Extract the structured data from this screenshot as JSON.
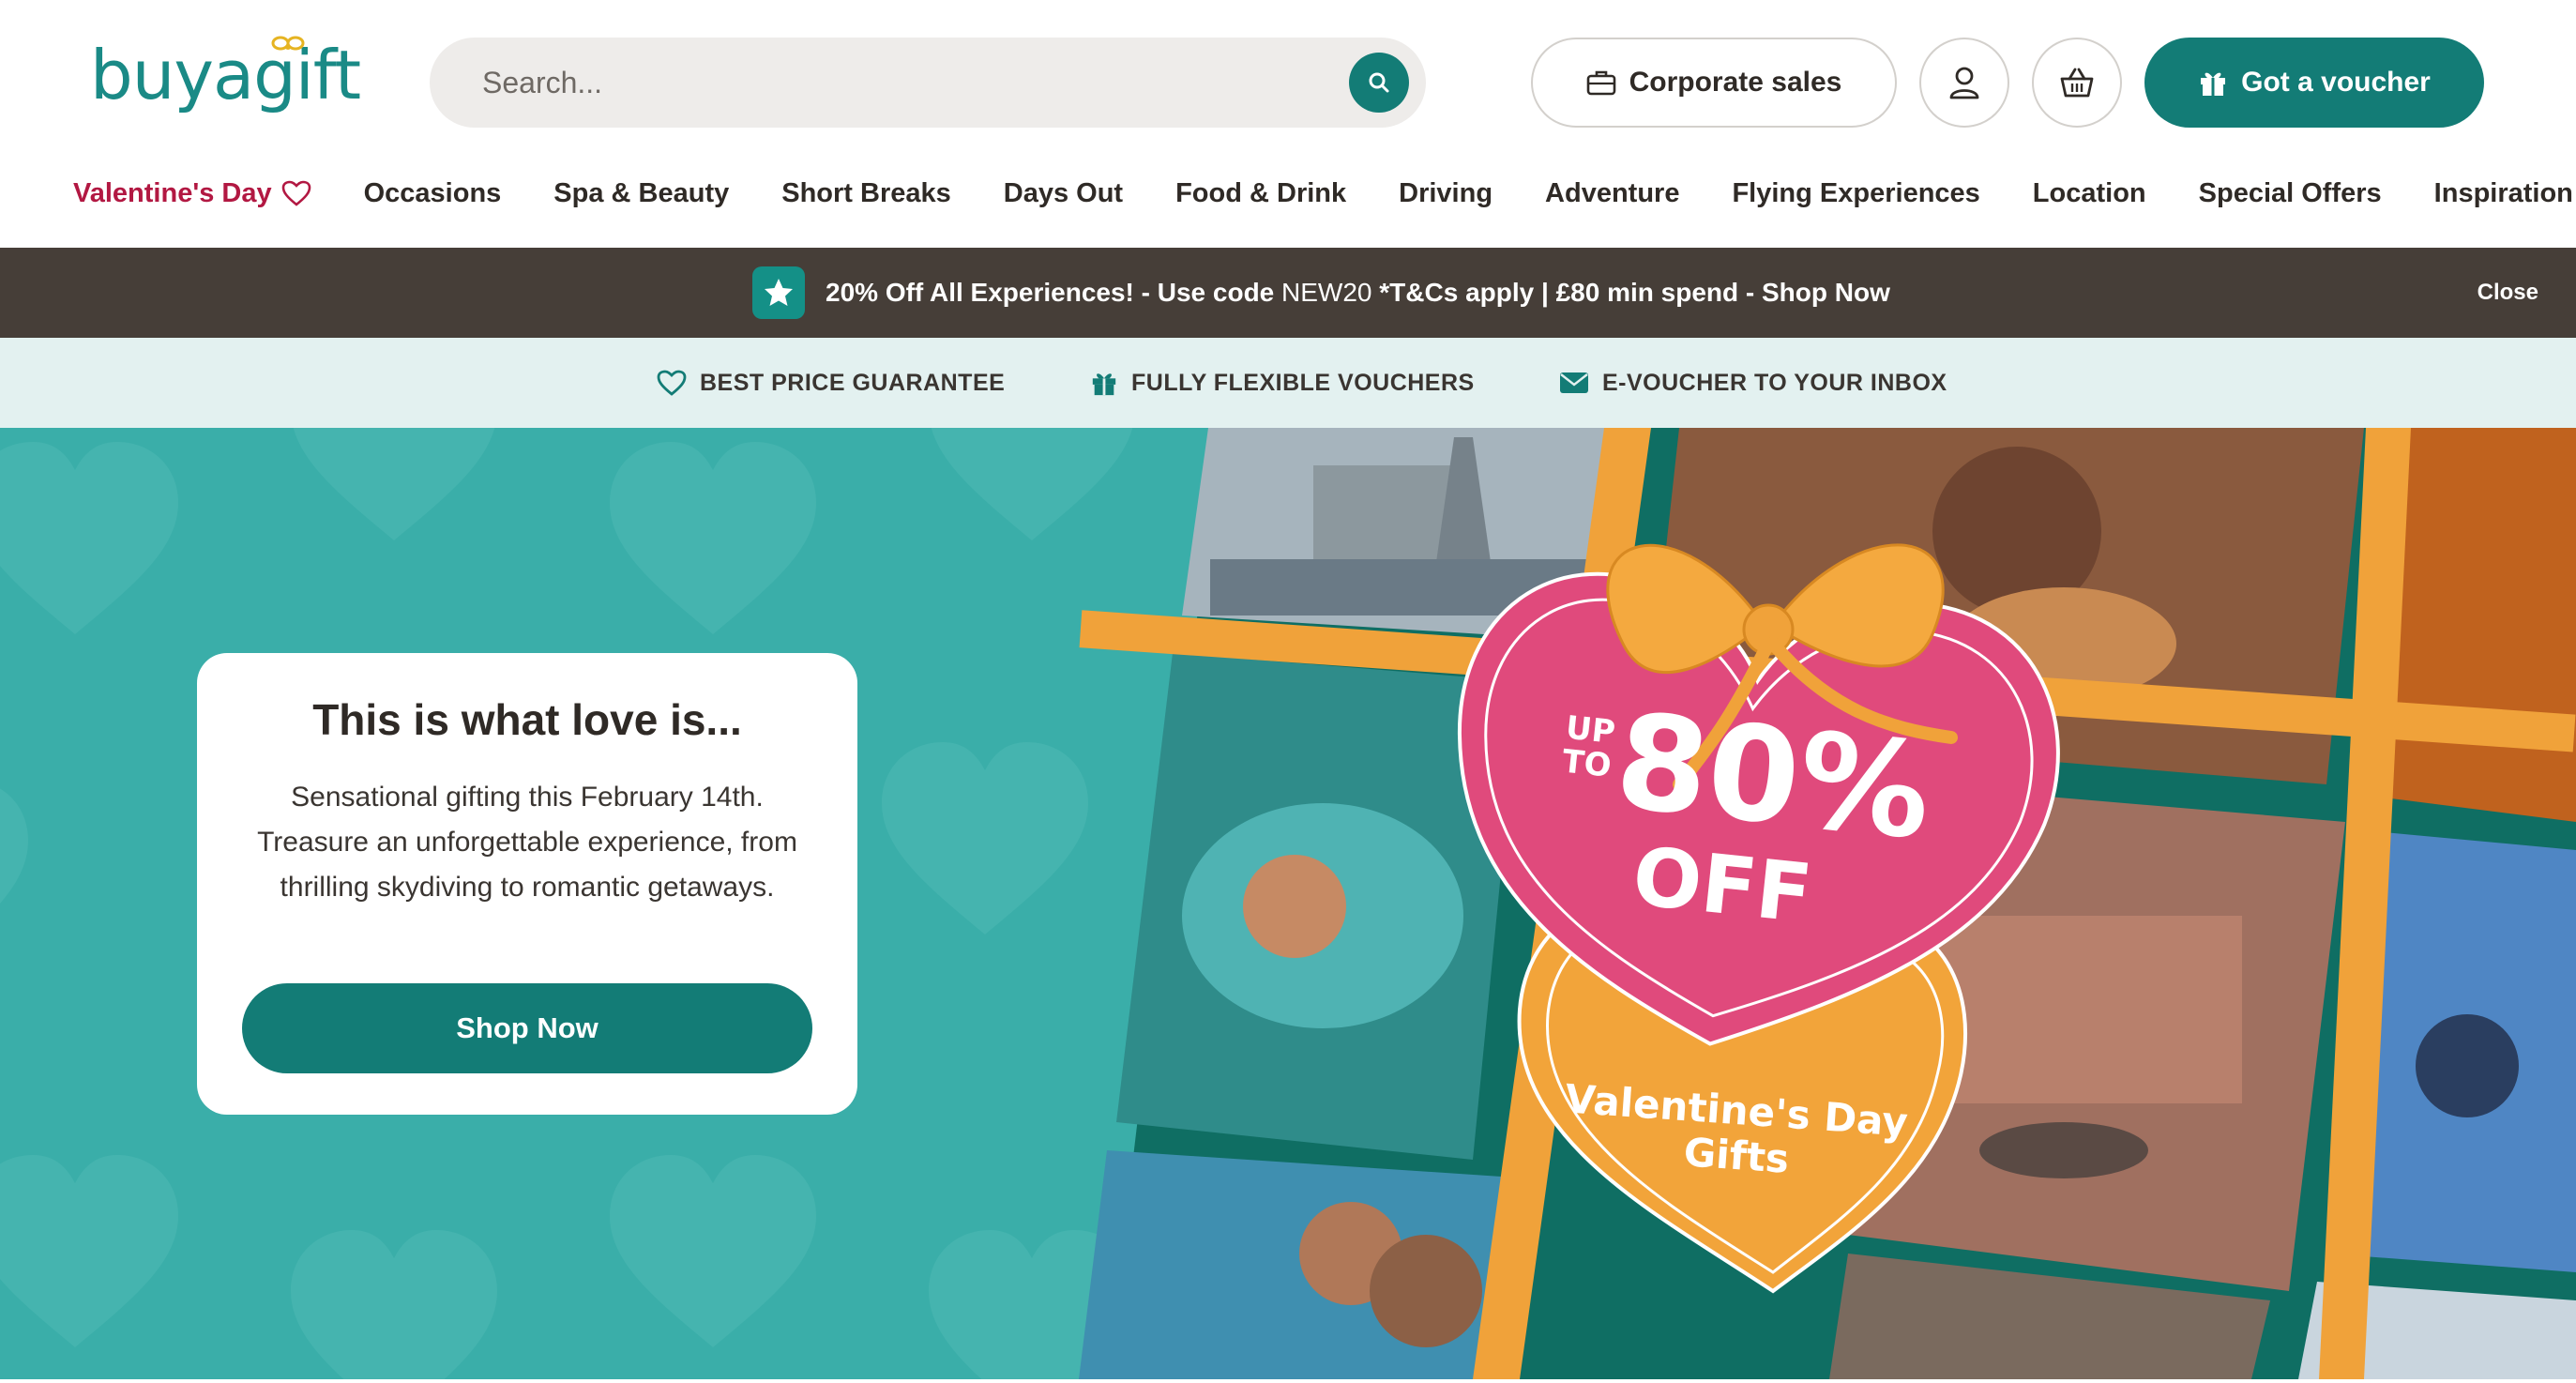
{
  "brand": {
    "logo_text": "buyagift"
  },
  "search": {
    "placeholder": "Search..."
  },
  "header": {
    "corporate_label": "Corporate sales",
    "voucher_label": "Got a voucher"
  },
  "nav": {
    "items": [
      "Valentine's Day",
      "Occasions",
      "Spa & Beauty",
      "Short Breaks",
      "Days Out",
      "Food & Drink",
      "Driving",
      "Adventure",
      "Flying Experiences",
      "Location",
      "Special Offers",
      "Inspiration"
    ]
  },
  "promo": {
    "text_before_code": "20% Off All Experiences! - Use code",
    "code": "NEW20",
    "text_after_code": "*T&Cs apply | £80 min spend - Shop Now",
    "close_label": "Close"
  },
  "usp": {
    "items": [
      "BEST PRICE GUARANTEE",
      "FULLY FLEXIBLE VOUCHERS",
      "E-VOUCHER TO YOUR INBOX"
    ]
  },
  "hero": {
    "title": "This is what love is...",
    "body": "Sensational gifting this February 14th. Treasure an unforgettable experience, from thrilling skydiving to romantic getaways.",
    "cta_label": "Shop Now",
    "banner": {
      "up": "UP",
      "to": "TO",
      "percent": "80%",
      "off": "OFF",
      "line1": "Valentine's Day",
      "line2": "Gifts"
    }
  },
  "colors": {
    "brand_teal": "#137c76",
    "hero_bg": "#3aaea9",
    "promo_bg": "#463e38",
    "usp_bg": "#e3f1f0",
    "valentine_red": "#b21842",
    "heart_pink": "#e04a7c",
    "heart_orange": "#f2a43a"
  }
}
